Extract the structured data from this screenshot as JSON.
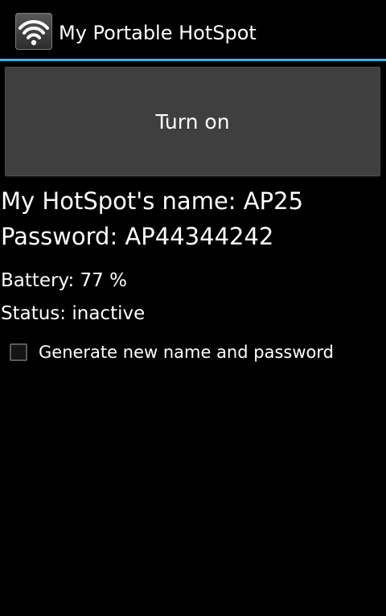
{
  "app": {
    "title": "My Portable HotSpot",
    "icon": "wifi-icon",
    "accent_color": "#33b5e5"
  },
  "main": {
    "turn_on_label": "Turn on",
    "hotspot_name_label": "My HotSpot's name:",
    "hotspot_name_value": "AP25",
    "password_label": "Password:",
    "password_value": "AP44344242",
    "battery_label": "Battery:",
    "battery_value": "77 %",
    "status_label": "Status:",
    "status_value": "inactive",
    "generate_checkbox_label": "Generate new name and password",
    "generate_checked": false
  }
}
